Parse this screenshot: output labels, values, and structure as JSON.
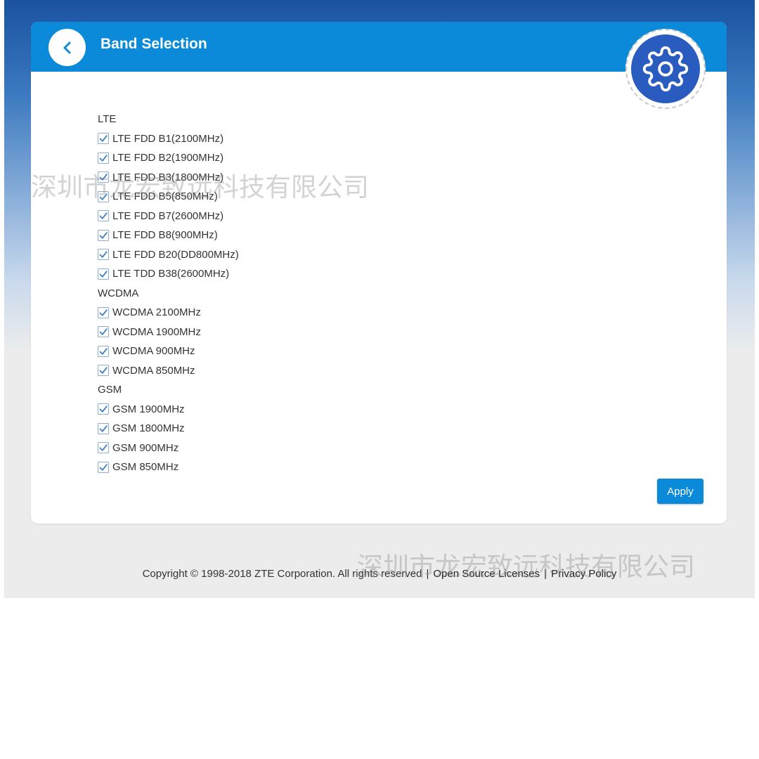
{
  "header": {
    "title": "Band Selection",
    "back_icon": "chevron-left-icon",
    "settings_icon": "gear-icon"
  },
  "colors": {
    "header_blue": "#0a8ad8",
    "gear_blue": "#2a5cbf",
    "check_blue": "#3a7fc8"
  },
  "groups": [
    {
      "label": "LTE",
      "bands": [
        {
          "label": "LTE FDD B1(2100MHz)",
          "checked": true
        },
        {
          "label": "LTE FDD B2(1900MHz)",
          "checked": true
        },
        {
          "label": "LTE FDD B3(1800MHz)",
          "checked": true
        },
        {
          "label": "LTE FDD B5(850MHz)",
          "checked": true
        },
        {
          "label": "LTE FDD B7(2600MHz)",
          "checked": true
        },
        {
          "label": "LTE FDD B8(900MHz)",
          "checked": true
        },
        {
          "label": "LTE FDD B20(DD800MHz)",
          "checked": true
        },
        {
          "label": "LTE TDD B38(2600MHz)",
          "checked": true
        }
      ]
    },
    {
      "label": "WCDMA",
      "bands": [
        {
          "label": "WCDMA 2100MHz",
          "checked": true
        },
        {
          "label": "WCDMA 1900MHz",
          "checked": true
        },
        {
          "label": "WCDMA 900MHz",
          "checked": true
        },
        {
          "label": "WCDMA 850MHz",
          "checked": true
        }
      ]
    },
    {
      "label": "GSM",
      "bands": [
        {
          "label": "GSM 1900MHz",
          "checked": true
        },
        {
          "label": "GSM 1800MHz",
          "checked": true
        },
        {
          "label": "GSM 900MHz",
          "checked": true
        },
        {
          "label": "GSM 850MHz",
          "checked": true
        }
      ]
    }
  ],
  "apply_label": "Apply",
  "footer": {
    "copyright": "Copyright © 1998-2018 ZTE Corporation. All rights reserved",
    "separator": "|",
    "open_source": "Open Source Licenses",
    "privacy": "Privacy Policy"
  },
  "watermark": "深圳市龙宏致远科技有限公司"
}
